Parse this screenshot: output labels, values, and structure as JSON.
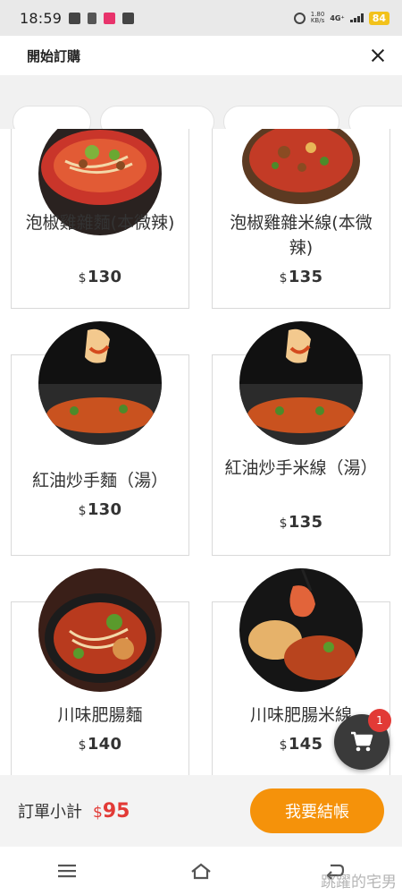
{
  "status_bar": {
    "time": "18:59",
    "net_speed_value": "1.80",
    "net_speed_unit": "KB/s",
    "network": "4G⁺",
    "battery": "84"
  },
  "header": {
    "title": "開始訂購"
  },
  "categories": [
    "",
    "",
    ""
  ],
  "products": [
    {
      "name": "泡椒雞雜麵(本微辣)",
      "currency": "$",
      "price": "130",
      "image": "bowl-of-spicy-noodles"
    },
    {
      "name": "泡椒雞雜米線(本微辣)",
      "currency": "$",
      "price": "135",
      "image": "bowl-of-spicy-rice-noodles"
    },
    {
      "name": "紅油炒手麵（湯）",
      "currency": "$",
      "price": "130",
      "image": "dumpling-noodle-bowl"
    },
    {
      "name": "紅油炒手米線（湯）",
      "currency": "$",
      "price": "135",
      "image": "dumpling-rice-noodle-bowl"
    },
    {
      "name": "川味肥腸麵",
      "currency": "$",
      "price": "140",
      "image": "intestine-noodle-bowl"
    },
    {
      "name": "川味肥腸米線",
      "currency": "$",
      "price": "145",
      "image": "intestine-rice-noodle-bowl"
    }
  ],
  "cart": {
    "count": "1"
  },
  "footer": {
    "subtotal_label": "訂單小計",
    "currency": "$",
    "subtotal_value": "95",
    "checkout_label": "我要結帳"
  },
  "watermark": "跳躍的宅男",
  "colors": {
    "accent_orange": "#f5920a",
    "price_red": "#e23a36",
    "fab_dark": "#3a3a3a"
  }
}
